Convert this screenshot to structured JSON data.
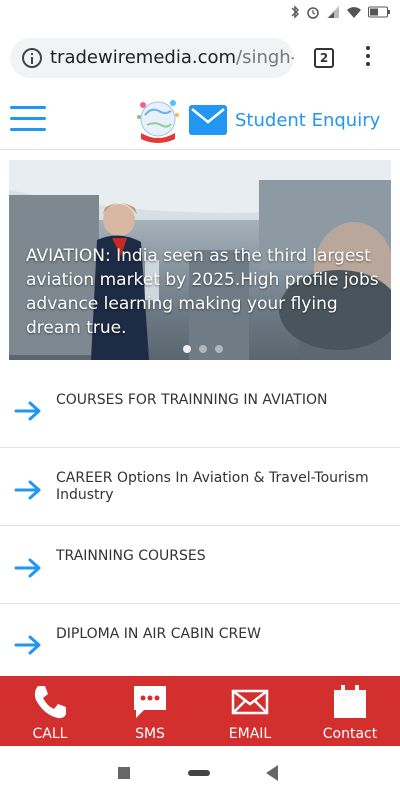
{
  "status_bar": {
    "icons": [
      "bluetooth-icon",
      "alarm-icon",
      "signal-icon",
      "wifi-icon",
      "battery-icon"
    ]
  },
  "browser": {
    "url_domain": "tradewiremedia.com",
    "url_path": "/singh-pa",
    "tab_count": "2"
  },
  "header": {
    "logo_icon": "globe-logo-icon",
    "enquiry_label": "Student Enquiry"
  },
  "hero": {
    "caption": "AVIATION: India seen as the third largest aviation market by 2025.High profile jobs advance learning making your flying dream true.",
    "slide_count": 3,
    "active_slide": 1
  },
  "menu": {
    "items": [
      {
        "label": "COURSES FOR TRAINNING IN AVIATION"
      },
      {
        "label": "CAREER Options In Aviation & Travel-Tourism Industry"
      },
      {
        "label": "TRAINNING COURSES"
      },
      {
        "label": "DIPLOMA IN AIR CABIN CREW"
      }
    ]
  },
  "actions": {
    "call": "CALL",
    "sms": "SMS",
    "email": "EMAIL",
    "contact": "Contact"
  },
  "colors": {
    "accent": "#2196f3",
    "action_bar": "#d32f2f"
  }
}
